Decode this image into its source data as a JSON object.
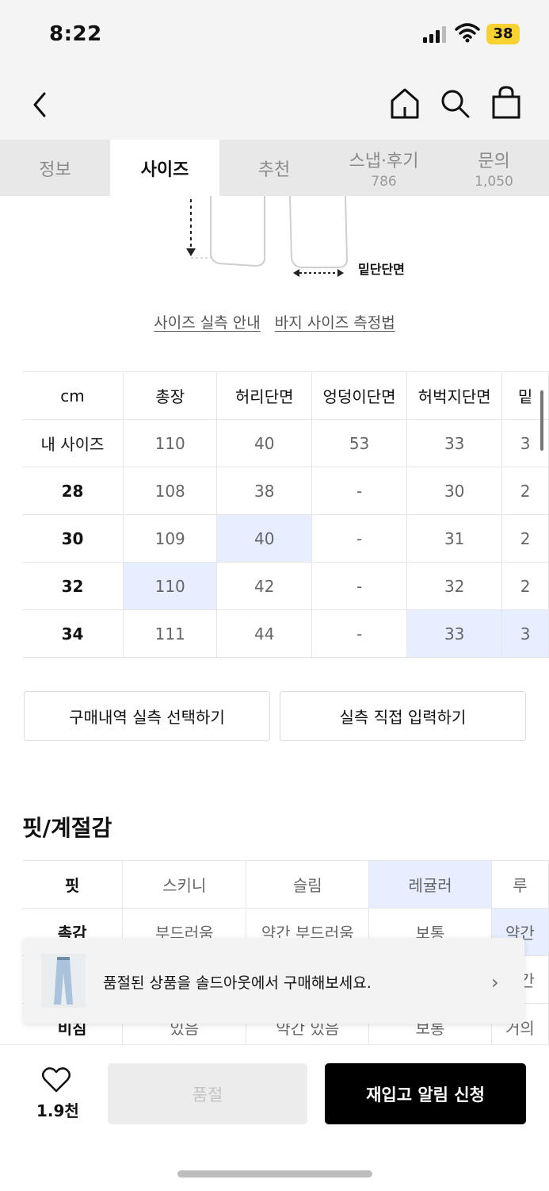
{
  "status": {
    "time": "8:22",
    "battery": "38"
  },
  "tabs": [
    {
      "label": "정보",
      "count": ""
    },
    {
      "label": "사이즈",
      "count": ""
    },
    {
      "label": "추천",
      "count": ""
    },
    {
      "label": "스냅·후기",
      "count": "786"
    },
    {
      "label": "문의",
      "count": "1,050"
    }
  ],
  "diagram": {
    "hem_label": "밑단단면"
  },
  "size_links": {
    "guide": "사이즈 실측 안내",
    "method": "바지 사이즈 측정법"
  },
  "size_table": {
    "headers": [
      "cm",
      "총장",
      "허리단면",
      "엉덩이단면",
      "허벅지단면",
      "밑"
    ],
    "rows": [
      [
        "내 사이즈",
        "110",
        "40",
        "53",
        "33",
        "3"
      ],
      [
        "28",
        "108",
        "38",
        "-",
        "30",
        "2"
      ],
      [
        "30",
        "109",
        "40",
        "-",
        "31",
        "2"
      ],
      [
        "32",
        "110",
        "42",
        "-",
        "32",
        "2"
      ],
      [
        "34",
        "111",
        "44",
        "-",
        "33",
        "3"
      ]
    ]
  },
  "buttons": {
    "purchase_history": "구매내역 실측 선택하기",
    "direct_input": "실측 직접 입력하기"
  },
  "fit_section": {
    "title": "핏/계절감",
    "rows": [
      [
        "핏",
        "스키니",
        "슬림",
        "레귤러",
        "루"
      ],
      [
        "촉감",
        "부드러움",
        "약간 부드러움",
        "보통",
        "약간"
      ],
      [
        "",
        "",
        "",
        "",
        "약간"
      ],
      [
        "비침",
        "있음",
        "약간 있음",
        "보통",
        "거의"
      ]
    ]
  },
  "banner": {
    "text": "품절된 상품을 솔드아웃에서 구매해보세요.",
    "arrow": "›"
  },
  "bottom": {
    "like_count": "1.9천",
    "soldout": "품절",
    "restock": "재입고 알림 신청"
  },
  "colors": {
    "highlight": "#e6eeff",
    "primary_button": "#000000"
  }
}
